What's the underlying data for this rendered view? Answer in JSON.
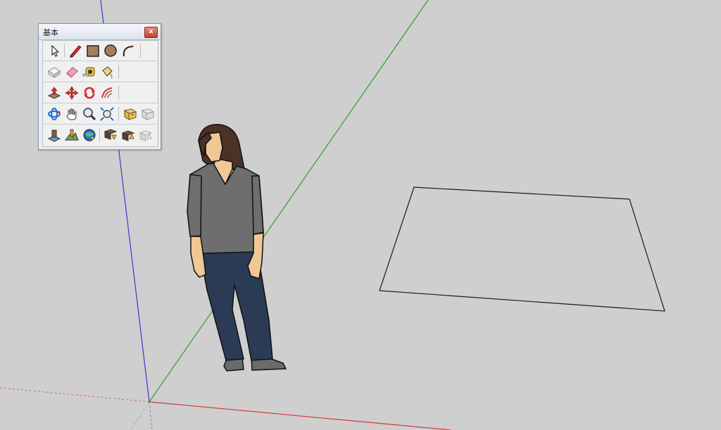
{
  "palette": {
    "title": "基本",
    "close_label": "x",
    "rows": [
      [
        {
          "name": "select-tool-icon"
        },
        {
          "name": "line-tool-icon"
        },
        {
          "name": "rectangle-tool-icon"
        },
        {
          "name": "circle-tool-icon"
        },
        {
          "name": "arc-tool-icon"
        }
      ],
      [
        {
          "name": "make-component-icon"
        },
        {
          "name": "eraser-tool-icon"
        },
        {
          "name": "tape-measure-tool-icon"
        },
        {
          "name": "paint-bucket-tool-icon"
        }
      ],
      [
        {
          "name": "push-pull-tool-icon"
        },
        {
          "name": "move-tool-icon"
        },
        {
          "name": "rotate-tool-icon"
        },
        {
          "name": "offset-tool-icon"
        }
      ],
      [
        {
          "name": "orbit-tool-icon"
        },
        {
          "name": "pan-tool-icon"
        },
        {
          "name": "zoom-tool-icon"
        },
        {
          "name": "zoom-extents-tool-icon"
        },
        {
          "name": "previous-view-icon"
        },
        {
          "name": "next-view-icon"
        }
      ],
      [
        {
          "name": "add-location-icon"
        },
        {
          "name": "toggle-terrain-icon"
        },
        {
          "name": "photo-textures-icon"
        },
        {
          "name": "get-models-icon"
        },
        {
          "name": "share-model-icon"
        },
        {
          "name": "share-component-icon"
        }
      ]
    ]
  },
  "colors": {
    "background": "#cfcfcf",
    "axis_red": "#d03a3a",
    "axis_green": "#2f9e2f",
    "axis_blue": "#3a3ad0",
    "edge": "#1a1a1a"
  }
}
